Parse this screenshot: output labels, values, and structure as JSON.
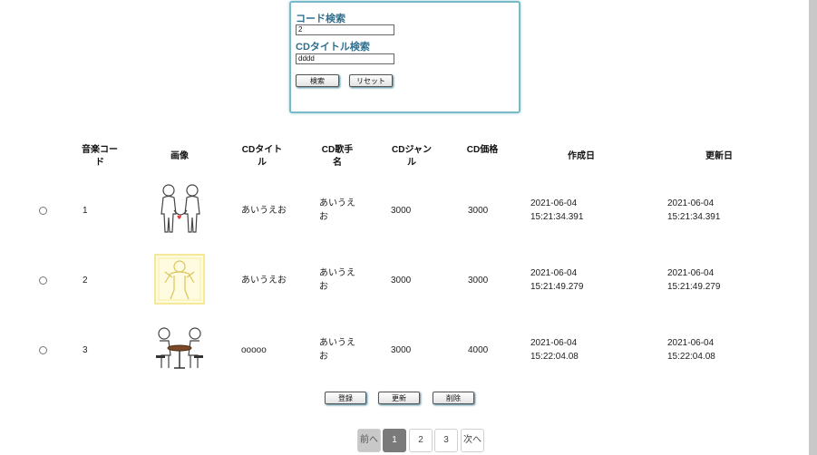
{
  "search": {
    "code_label": "コード検索",
    "code_value": "2",
    "title_label": "CDタイトル検索",
    "title_value": "dddd",
    "search_button": "検索",
    "reset_button": "リセット"
  },
  "table": {
    "headers": [
      "音楽コード",
      "画像",
      "CDタイトル",
      "CD歌手名",
      "CDジャンル",
      "CD価格",
      "作成日",
      "更新日"
    ],
    "rows": [
      {
        "code": "1",
        "title": "あいうえお",
        "singer": "あいうえお",
        "genre": "3000",
        "price": "3000",
        "created_date": "2021-06-04",
        "created_time": "15:21:34.391",
        "updated_date": "2021-06-04",
        "updated_time": "15:21:34.391",
        "image": "two-figures-holding-hands"
      },
      {
        "code": "2",
        "title": "あいうえお",
        "singer": "あいうえお",
        "genre": "3000",
        "price": "3000",
        "created_date": "2021-06-04",
        "created_time": "15:21:49.279",
        "updated_date": "2021-06-04",
        "updated_time": "15:21:49.279",
        "image": "figure-with-yellow-frame"
      },
      {
        "code": "3",
        "title": "ooooo",
        "singer": "あいうえお",
        "genre": "3000",
        "price": "4000",
        "created_date": "2021-06-04",
        "created_time": "15:22:04.08",
        "updated_date": "2021-06-04",
        "updated_time": "15:22:04.08",
        "image": "two-figures-at-table"
      }
    ]
  },
  "actions": {
    "register": "登録",
    "update": "更新",
    "delete": "削除"
  },
  "pagination": {
    "prev": "前へ",
    "pages": [
      "1",
      "2",
      "3"
    ],
    "current": "1",
    "next": "次へ"
  },
  "colors": {
    "search_border": "#7ab9c8",
    "label": "#2f6f8e",
    "active_page": "#7a7a7a",
    "disabled_page": "#c8c8c8"
  }
}
